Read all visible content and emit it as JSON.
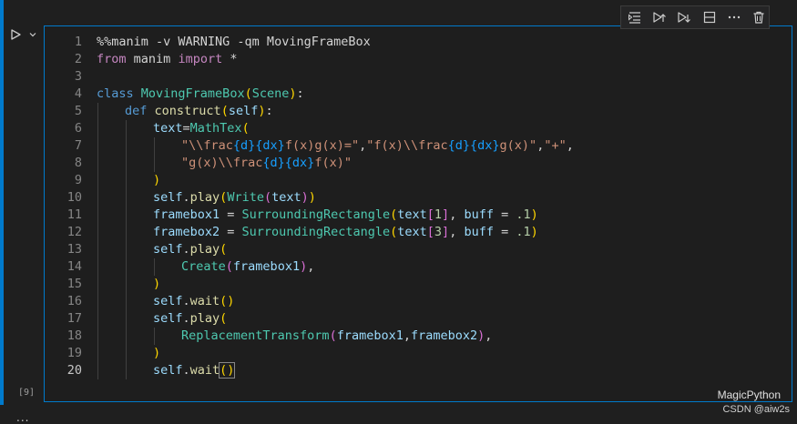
{
  "cell": {
    "execution_count": "[9]",
    "language": "MagicPython",
    "lines": [
      {
        "n": "1",
        "indent": 0,
        "t": [
          [
            "plain",
            "%%manim -v WARNING -qm MovingFrameBox"
          ]
        ]
      },
      {
        "n": "2",
        "indent": 0,
        "t": [
          [
            "kw",
            "from"
          ],
          [
            "plain",
            " "
          ],
          [
            "plain",
            "manim"
          ],
          [
            "plain",
            " "
          ],
          [
            "kw",
            "import"
          ],
          [
            "plain",
            " *"
          ]
        ]
      },
      {
        "n": "3",
        "indent": 0,
        "t": []
      },
      {
        "n": "4",
        "indent": 0,
        "t": [
          [
            "def",
            "class"
          ],
          [
            "plain",
            " "
          ],
          [
            "cls",
            "MovingFrameBox"
          ],
          [
            "br1",
            "("
          ],
          [
            "cls",
            "Scene"
          ],
          [
            "br1",
            ")"
          ],
          [
            "plain",
            ":"
          ]
        ]
      },
      {
        "n": "5",
        "indent": 1,
        "t": [
          [
            "def",
            "def"
          ],
          [
            "plain",
            " "
          ],
          [
            "fn",
            "construct"
          ],
          [
            "br1",
            "("
          ],
          [
            "var",
            "self"
          ],
          [
            "br1",
            ")"
          ],
          [
            "plain",
            ":"
          ]
        ]
      },
      {
        "n": "6",
        "indent": 2,
        "t": [
          [
            "var",
            "text"
          ],
          [
            "plain",
            "="
          ],
          [
            "cls",
            "MathTex"
          ],
          [
            "br1",
            "("
          ]
        ]
      },
      {
        "n": "7",
        "indent": 3,
        "t": [
          [
            "str",
            "\"\\\\frac"
          ],
          [
            "br3",
            "{d}{dx}"
          ],
          [
            "str",
            "f(x)g(x)=\""
          ],
          [
            "plain",
            ","
          ],
          [
            "str",
            "\"f(x)\\\\frac"
          ],
          [
            "br3",
            "{d}{dx}"
          ],
          [
            "str",
            "g(x)\""
          ],
          [
            "plain",
            ","
          ],
          [
            "str",
            "\"+\""
          ],
          [
            "plain",
            ","
          ]
        ]
      },
      {
        "n": "8",
        "indent": 3,
        "t": [
          [
            "str",
            "\"g(x)\\\\frac"
          ],
          [
            "br3",
            "{d}{dx}"
          ],
          [
            "str",
            "f(x)\""
          ]
        ]
      },
      {
        "n": "9",
        "indent": 2,
        "t": [
          [
            "br1",
            ")"
          ]
        ]
      },
      {
        "n": "10",
        "indent": 2,
        "t": [
          [
            "var",
            "self"
          ],
          [
            "plain",
            "."
          ],
          [
            "fn",
            "play"
          ],
          [
            "br1",
            "("
          ],
          [
            "cls",
            "Write"
          ],
          [
            "br2",
            "("
          ],
          [
            "var",
            "text"
          ],
          [
            "br2",
            ")"
          ],
          [
            "br1",
            ")"
          ]
        ]
      },
      {
        "n": "11",
        "indent": 2,
        "t": [
          [
            "var",
            "framebox1"
          ],
          [
            "plain",
            " = "
          ],
          [
            "cls",
            "SurroundingRectangle"
          ],
          [
            "br1",
            "("
          ],
          [
            "var",
            "text"
          ],
          [
            "br2",
            "["
          ],
          [
            "num",
            "1"
          ],
          [
            "br2",
            "]"
          ],
          [
            "plain",
            ", "
          ],
          [
            "var",
            "buff"
          ],
          [
            "plain",
            " = "
          ],
          [
            "num",
            ".1"
          ],
          [
            "br1",
            ")"
          ]
        ]
      },
      {
        "n": "12",
        "indent": 2,
        "t": [
          [
            "var",
            "framebox2"
          ],
          [
            "plain",
            " = "
          ],
          [
            "cls",
            "SurroundingRectangle"
          ],
          [
            "br1",
            "("
          ],
          [
            "var",
            "text"
          ],
          [
            "br2",
            "["
          ],
          [
            "num",
            "3"
          ],
          [
            "br2",
            "]"
          ],
          [
            "plain",
            ", "
          ],
          [
            "var",
            "buff"
          ],
          [
            "plain",
            " = "
          ],
          [
            "num",
            ".1"
          ],
          [
            "br1",
            ")"
          ]
        ]
      },
      {
        "n": "13",
        "indent": 2,
        "t": [
          [
            "var",
            "self"
          ],
          [
            "plain",
            "."
          ],
          [
            "fn",
            "play"
          ],
          [
            "br1",
            "("
          ]
        ]
      },
      {
        "n": "14",
        "indent": 3,
        "t": [
          [
            "cls",
            "Create"
          ],
          [
            "br2",
            "("
          ],
          [
            "var",
            "framebox1"
          ],
          [
            "br2",
            ")"
          ],
          [
            "plain",
            ","
          ]
        ]
      },
      {
        "n": "15",
        "indent": 2,
        "t": [
          [
            "br1",
            ")"
          ]
        ]
      },
      {
        "n": "16",
        "indent": 2,
        "t": [
          [
            "var",
            "self"
          ],
          [
            "plain",
            "."
          ],
          [
            "fn",
            "wait"
          ],
          [
            "br1",
            "()"
          ]
        ]
      },
      {
        "n": "17",
        "indent": 2,
        "t": [
          [
            "var",
            "self"
          ],
          [
            "plain",
            "."
          ],
          [
            "fn",
            "play"
          ],
          [
            "br1",
            "("
          ]
        ]
      },
      {
        "n": "18",
        "indent": 3,
        "t": [
          [
            "cls",
            "ReplacementTransform"
          ],
          [
            "br2",
            "("
          ],
          [
            "var",
            "framebox1"
          ],
          [
            "plain",
            ","
          ],
          [
            "var",
            "framebox2"
          ],
          [
            "br2",
            ")"
          ],
          [
            "plain",
            ","
          ]
        ]
      },
      {
        "n": "19",
        "indent": 2,
        "t": [
          [
            "br1",
            ")"
          ]
        ]
      },
      {
        "n": "20",
        "indent": 2,
        "active": true,
        "t": [
          [
            "var",
            "self"
          ],
          [
            "plain",
            "."
          ],
          [
            "fn",
            "wait"
          ],
          [
            "br1",
            "()"
          ]
        ]
      }
    ]
  },
  "toolbar": {
    "icons": [
      "run-by-line-icon",
      "execute-above-icon",
      "execute-below-icon",
      "split-cell-icon",
      "more-actions-icon",
      "delete-cell-icon"
    ]
  },
  "footer": {
    "watermark": "CSDN @aiw2s",
    "output_toggle": "..."
  },
  "colors": {
    "accent": "#007acc",
    "editor_bg": "#1e1e1e"
  }
}
